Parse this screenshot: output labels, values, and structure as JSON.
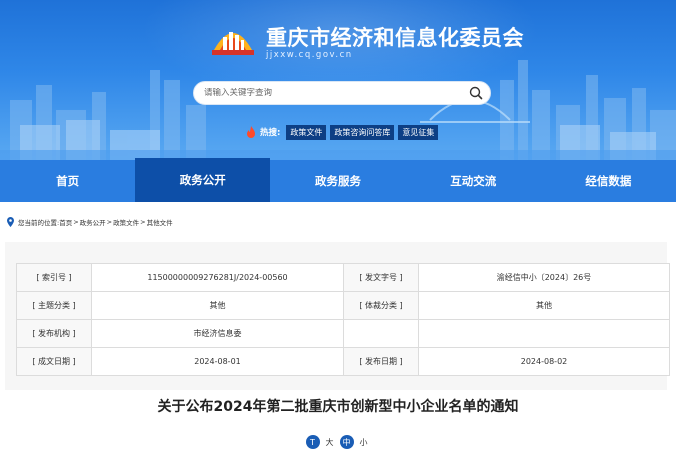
{
  "header": {
    "site_title": "重庆市经济和信息化委员会",
    "site_domain": "jjxxw.cq.gov.cn",
    "search_placeholder": "请输入关键字查询",
    "hot_label": "热搜:",
    "hot_tags": [
      "政策文件",
      "政策咨询问答库",
      "意见征集"
    ]
  },
  "nav": {
    "items": [
      "首页",
      "政务公开",
      "政务服务",
      "互动交流",
      "经信数据"
    ],
    "active": "政务公开"
  },
  "breadcrumb": {
    "prefix": "您当前的位置:",
    "items": [
      "首页",
      "政务公开",
      "政策文件",
      "其他文件"
    ],
    "sep": ">"
  },
  "info_table": {
    "rows": [
      [
        "[ 索引号 ]",
        "11500000009276281J/2024-00560",
        "[ 发文字号 ]",
        "渝经信中小〔2024〕26号"
      ],
      [
        "[ 主题分类 ]",
        "其他",
        "[ 体裁分类 ]",
        "其他"
      ],
      [
        "[ 发布机构 ]",
        "市经济信息委",
        "",
        ""
      ],
      [
        "[ 成文日期 ]",
        "2024-08-01",
        "[ 发布日期 ]",
        "2024-08-02"
      ]
    ]
  },
  "document": {
    "title": "关于公布2024年第二批重庆市创新型中小企业名单的通知"
  },
  "font_size": {
    "options": [
      "T",
      "大",
      "中",
      "小"
    ]
  },
  "colors": {
    "banner": "#2f87e8",
    "nav": "#2a7de0",
    "nav_active": "#0d4fa8",
    "tag": "#0d3f85"
  }
}
